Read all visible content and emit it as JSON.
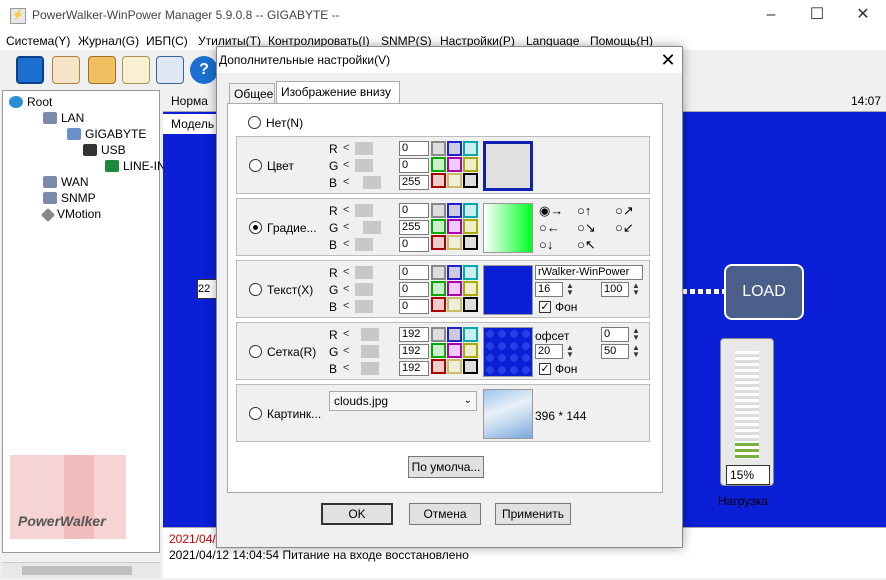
{
  "window": {
    "title": "PowerWalker-WinPower Manager 5.9.0.8 -- GIGABYTE --"
  },
  "menu": [
    "Система(Y)",
    "Журнал(G)",
    "ИБП(C)",
    "Утилиты(T)",
    "Контролировать(I)",
    "SNMP(S)",
    "Настройки(P)",
    "Language",
    "Помощь(H)"
  ],
  "tree": {
    "root": "Root",
    "lan": "LAN",
    "host": "GIGABYTE",
    "usb": "USB",
    "ups": "LINE-IN",
    "wan": "WAN",
    "snmp": "SNMP",
    "vmotion": "VMotion"
  },
  "logo": "PowerWalker",
  "main": {
    "header_left": "Норма",
    "header_right": "14:07",
    "sub_header": "Модель",
    "input_left": "22",
    "load_label": "LOAD",
    "gauge_percent": "15%",
    "gauge_value": 0.15,
    "gauge_caption": "Нагрузка"
  },
  "log": {
    "line1": "2021/04/",
    "line2": "2021/04/12 14:04:54  Питание на входе восстановлено"
  },
  "dialog": {
    "title": "Дополнительные настройки(V)",
    "tabs": [
      "Общее",
      "Изображение внизу"
    ],
    "none_label": "Нет(N)",
    "rows": {
      "color": {
        "label": "Цвет",
        "r": "0",
        "g": "0",
        "b": "255"
      },
      "gradient": {
        "label": "Градие...",
        "r": "0",
        "g": "255",
        "b": "0"
      },
      "text": {
        "label": "Текст(X)",
        "r": "0",
        "g": "0",
        "b": "0",
        "text_value": "rWalker-WinPower",
        "size": "16",
        "size2": "100",
        "bg_label": "Фон"
      },
      "grid": {
        "label": "Сетка(R)",
        "r": "192",
        "g": "192",
        "b": "192",
        "offset_label": "офсет",
        "offset": "0",
        "cell": "20",
        "cell2": "50",
        "bg_label": "Фон"
      },
      "image": {
        "label": "Картинк...",
        "file": "clouds.jpg",
        "size": "396 * 144"
      }
    },
    "channel_labels": {
      "r": "R",
      "g": "G",
      "b": "B"
    },
    "defaults_button": "По умолча...",
    "ok_button": "OK",
    "cancel_button": "Отмена",
    "apply_button": "Применить"
  },
  "colors": {
    "main_bg": "#0a1fd6",
    "accent_green": "#00ff22",
    "blue": "#0000ff"
  }
}
